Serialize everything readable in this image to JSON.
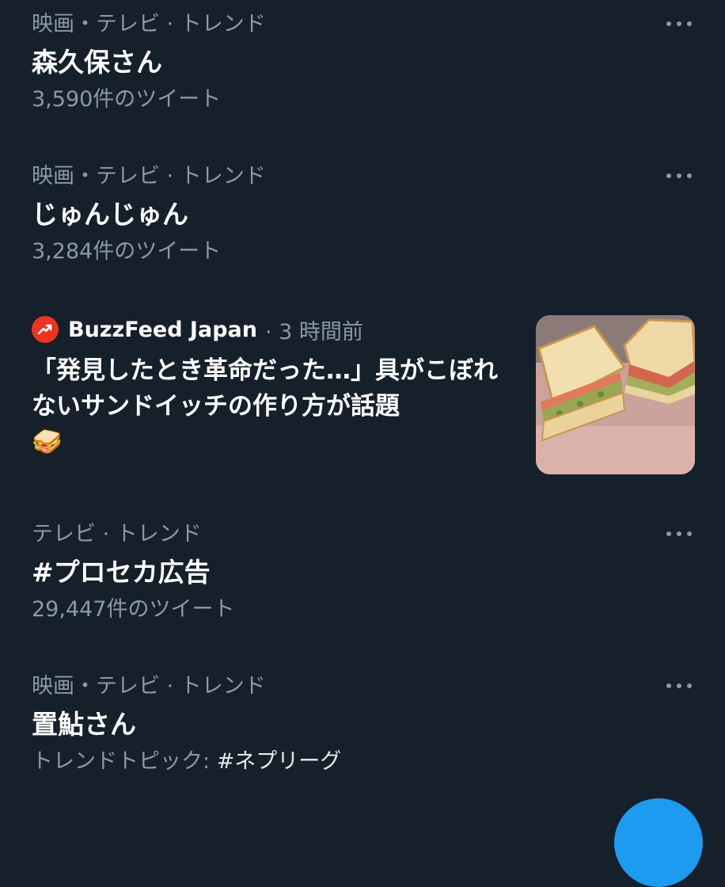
{
  "trends": [
    {
      "context": "映画・テレビ · トレンド",
      "title": "森久保さん",
      "meta": "3,590件のツイート"
    },
    {
      "context": "映画・テレビ · トレンド",
      "title": "じゅんじゅん",
      "meta": "3,284件のツイート"
    },
    {
      "context": "テレビ · トレンド",
      "title": "#プロセカ広告",
      "meta": "29,447件のツイート"
    },
    {
      "context": "映画・テレビ · トレンド",
      "title": "置鮎さん",
      "meta_prefix": "トレンドトピック: ",
      "meta_topic": "#ネプリーグ"
    }
  ],
  "news": {
    "source_name": "BuzzFeed Japan",
    "source_logo_icon": "trending-arrow-icon",
    "source_logo_color": "#ee3322",
    "time": "· 3 時間前",
    "headline": "「発見したとき革命だった…」具がこぼれないサンドイッチの作り方が話題",
    "emoji": "🥪",
    "thumbnail_icon": "sandwich-photo"
  },
  "colors": {
    "background": "#15202b",
    "secondary_text": "#8b98a5",
    "primary_text": "#ffffff",
    "accent": "#1d9bf0"
  }
}
